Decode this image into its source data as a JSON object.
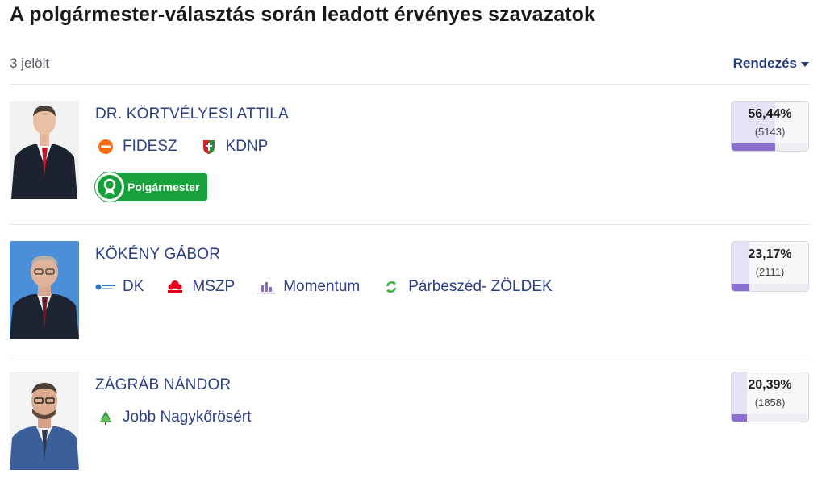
{
  "page_title": "A polgármester-választás során leadott érvényes szavazatok",
  "candidate_count": "3 jelölt",
  "sort_label": "Rendezés",
  "mayor_badge_label": "Polgármester",
  "colors": {
    "accent": "#2b3f86",
    "mayor_badge": "#17a13a",
    "result_bar": "#8a6fd1"
  },
  "candidates": [
    {
      "name": "DR. KÖRTVÉLYESI ATTILA",
      "parties": [
        {
          "name": "FIDESZ",
          "logo": "fidesz-logo"
        },
        {
          "name": "KDNP",
          "logo": "kdnp-logo"
        }
      ],
      "is_mayor": true,
      "percent": "56,44%",
      "percent_value": 56.44,
      "votes": "(5143)"
    },
    {
      "name": "KÖKÉNY GÁBOR",
      "parties": [
        {
          "name": "DK",
          "logo": "dk-logo"
        },
        {
          "name": "MSZP",
          "logo": "mszp-logo"
        },
        {
          "name": "Momentum",
          "logo": "momentum-logo"
        },
        {
          "name": "Párbeszéd- ZÖLDEK",
          "logo": "parbeszed-logo"
        }
      ],
      "is_mayor": false,
      "percent": "23,17%",
      "percent_value": 23.17,
      "votes": "(2111)"
    },
    {
      "name": "ZÁGRÁB NÁNDOR",
      "parties": [
        {
          "name": "Jobb Nagykőrösért",
          "logo": "jobb-nagykorosert-logo"
        }
      ],
      "is_mayor": false,
      "percent": "20,39%",
      "percent_value": 20.39,
      "votes": "(1858)"
    }
  ]
}
